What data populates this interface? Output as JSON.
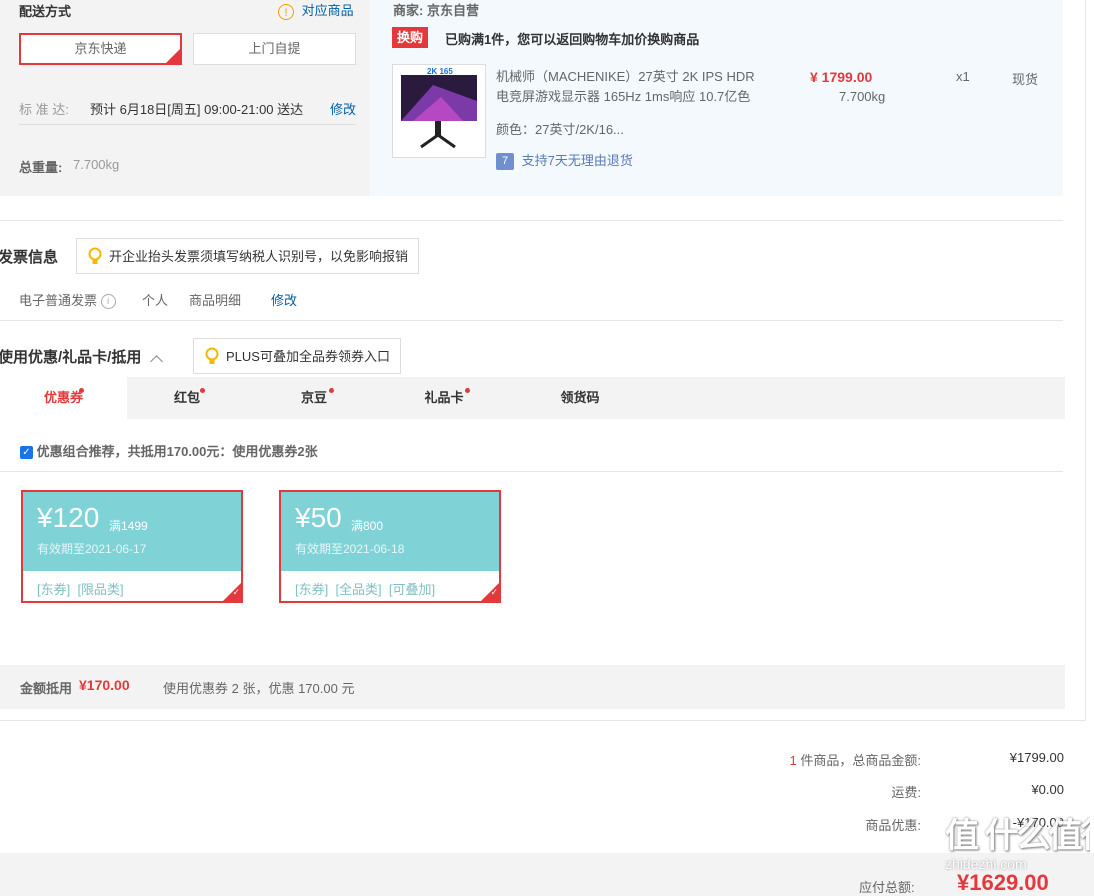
{
  "delivery": {
    "title": "配送方式",
    "match_goods_label": "对应商品",
    "options": [
      "京东快递",
      "上门自提"
    ],
    "standard_label": "标 准 达:",
    "standard_text": "预计 6月18日[周五] 09:00-21:00 送达",
    "modify": "修改",
    "weight_label": "总重量:",
    "weight_value": "7.700kg"
  },
  "seller": {
    "label": "商家:",
    "name": "京东自营",
    "badge": "换购",
    "promo": "已购满1件，您可以返回购物车加价换购商品",
    "product_line1": "机械师（MACHENIKE）27英寸 2K IPS HDR",
    "product_line2": "电竞屏游戏显示器 165Hz 1ms响应 10.7亿色",
    "price": "¥ 1799.00",
    "weight": "7.700kg",
    "qty": "x1",
    "stock": "现货",
    "color": "颜色：27英寸/2K/16...",
    "return_icon": "7",
    "return_text": "支持7天无理由退货",
    "image_text": "2K 165"
  },
  "invoice": {
    "title": "发票信息",
    "tip": "开企业抬头发票须填写纳税人识别号，以免影响报销",
    "type": "电子普通发票",
    "personal": "个人",
    "detail": "商品明细",
    "modify": "修改"
  },
  "discount": {
    "title": "使用优惠/礼品卡/抵用",
    "tip": "PLUS可叠加全品券领券入口",
    "tabs": [
      "优惠券",
      "红包",
      "京豆",
      "礼品卡",
      "领货码"
    ],
    "recommend": "优惠组合推荐，共抵用170.00元：使用优惠券2张",
    "coupons": [
      {
        "amount": "¥120",
        "cond": "满1499",
        "expiry": "有效期至2021-06-17",
        "tags": "[东券]  [限品类]"
      },
      {
        "amount": "¥50",
        "cond": "满800",
        "expiry": "有效期至2021-06-18",
        "tags": "[东券]  [全品类]  [可叠加]"
      }
    ],
    "deduct_label": "金额抵用",
    "deduct_value": "¥170.00",
    "deduct_desc": "使用优惠券 2 张，优惠 170.00 元"
  },
  "summary": {
    "count": "1",
    "count_text": "件商品，总商品金额:",
    "goods_total": "¥1799.00",
    "freight_label": "运费:",
    "freight": "¥0.00",
    "discount_label": "商品优惠:",
    "discount": "-¥170.00",
    "payable_label": "应付总额:",
    "payable": "¥1629.00"
  },
  "watermark": {
    "text": "值 什么值得买",
    "domain": "zhidezhi.com"
  }
}
